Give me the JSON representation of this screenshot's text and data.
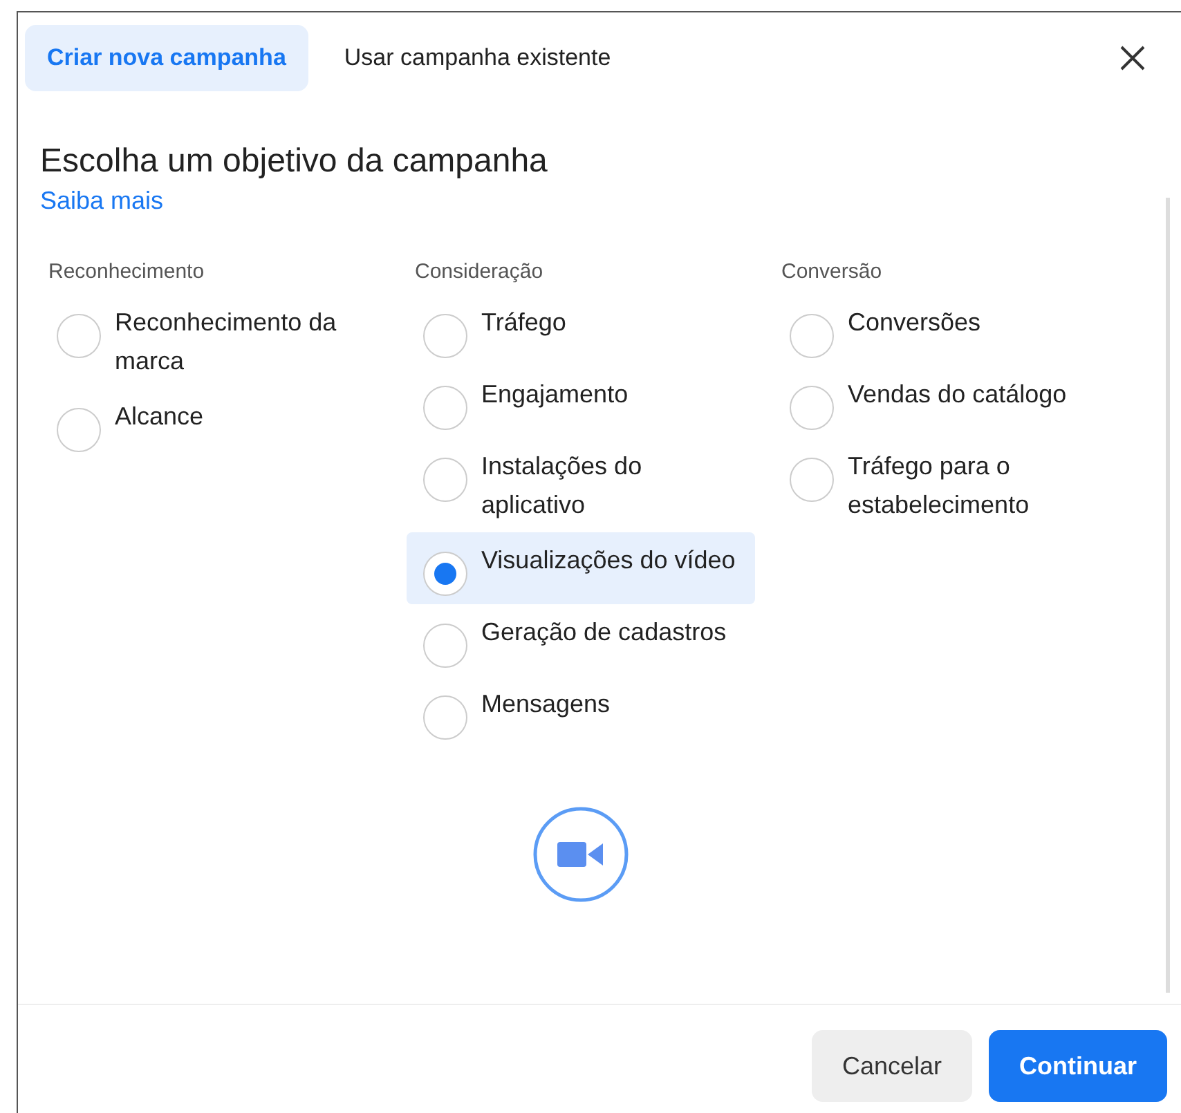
{
  "tabs": [
    {
      "label": "Criar nova campanha",
      "selected": true
    },
    {
      "label": "Usar campanha existente",
      "selected": false
    }
  ],
  "heading": "Escolha um objetivo da campanha",
  "learn_more": "Saiba mais",
  "columns": [
    {
      "title": "Reconhecimento",
      "options": [
        {
          "label": "Reconhecimento da marca",
          "selected": false
        },
        {
          "label": "Alcance",
          "selected": false
        }
      ]
    },
    {
      "title": "Consideração",
      "options": [
        {
          "label": "Tráfego",
          "selected": false
        },
        {
          "label": "Engajamento",
          "selected": false
        },
        {
          "label": "Instalações do aplicativo",
          "selected": false
        },
        {
          "label": "Visualizações do vídeo",
          "selected": true
        },
        {
          "label": "Geração de cadastros",
          "selected": false
        },
        {
          "label": "Mensagens",
          "selected": false
        }
      ]
    },
    {
      "title": "Conversão",
      "options": [
        {
          "label": "Conversões",
          "selected": false
        },
        {
          "label": "Vendas do catálogo",
          "selected": false
        },
        {
          "label": "Tráfego para o estabelecimento",
          "selected": false
        }
      ]
    }
  ],
  "buttons": [
    {
      "label": "Cancelar",
      "kind": "secondary"
    },
    {
      "label": "Continuar",
      "kind": "primary"
    }
  ]
}
